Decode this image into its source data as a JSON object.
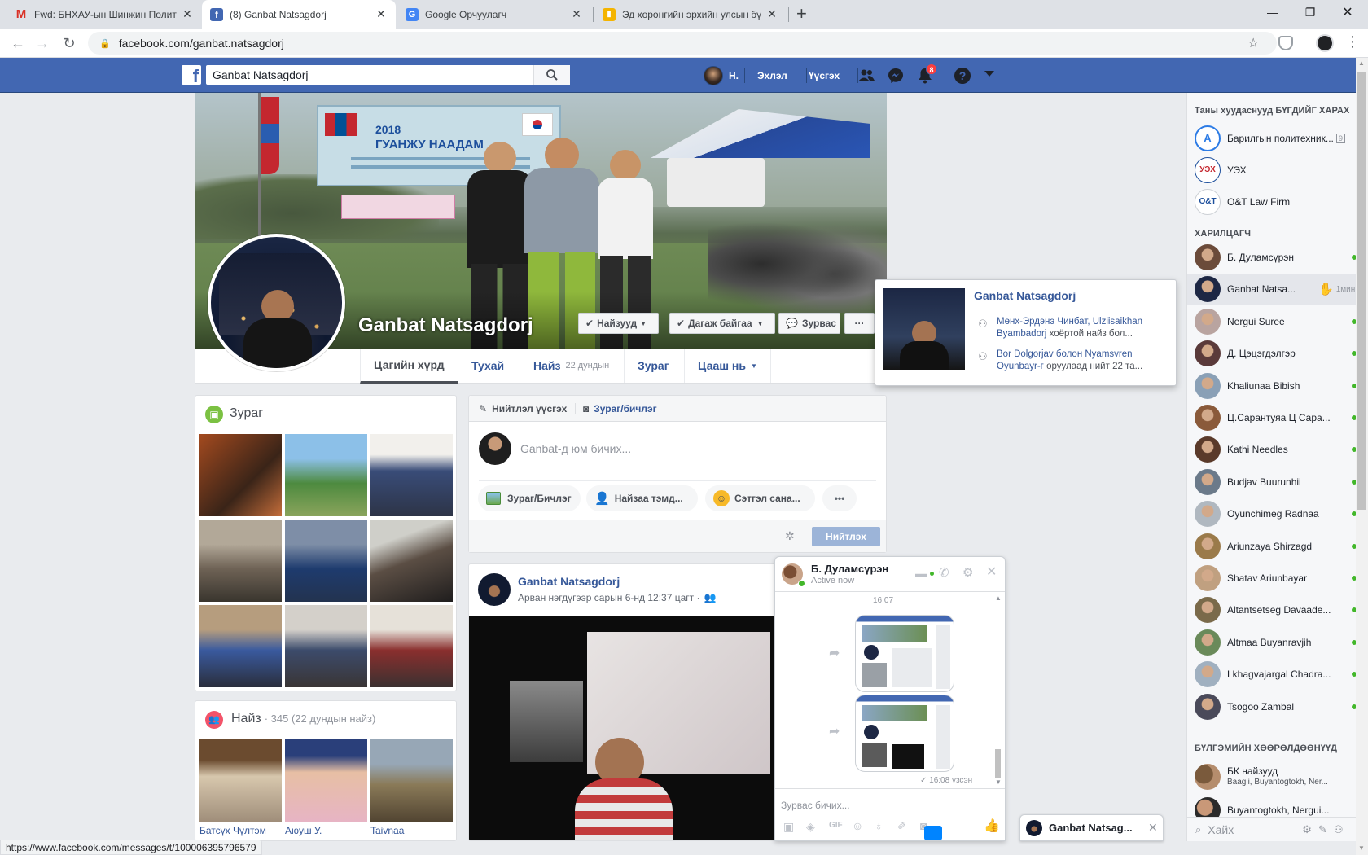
{
  "browser": {
    "tabs": [
      {
        "title": "Fwd: БНХАУ-ын Шинжин Полит",
        "favicon": "gmail-icon"
      },
      {
        "title": "(8) Ganbat Natsagdorj",
        "favicon": "facebook-icon",
        "active": true
      },
      {
        "title": "Google Орчуулагч",
        "favicon": "google-translate-icon"
      },
      {
        "title": "Эд хөрөнгийн эрхийн улсын бү",
        "favicon": "document-icon"
      }
    ],
    "url": "facebook.com/ganbat.natsagdorj",
    "status_url": "https://www.facebook.com/messages/t/100006395796579"
  },
  "fb_header": {
    "search_value": "Ganbat Natsagdorj",
    "user_short": "Н.",
    "home": "Эхлэл",
    "create": "Үүсгэх",
    "notification_count": "8"
  },
  "profile": {
    "name": "Ganbat Natsagdorj",
    "friends_button": "Найзууд",
    "following_button": "Дагаж байгаа",
    "message_button": "Зурвас",
    "more": "···",
    "banner_year": "2018",
    "banner_text": "ГУАНЖУ НААДАМ",
    "tabs": [
      {
        "label": "Цагийн хүрд"
      },
      {
        "label": "Тухай"
      },
      {
        "label": "Найз",
        "sub": "22 дундын"
      },
      {
        "label": "Зураг"
      },
      {
        "label": "Цааш нь"
      }
    ]
  },
  "photos_card": {
    "title": "Зураг"
  },
  "friends_card": {
    "title": "Найз",
    "count": "· 345 (22 дундын найз)",
    "friends": [
      "Батсүх Чүлтэм",
      "Аюуш У.",
      "Taivnaa"
    ]
  },
  "composer": {
    "tab_post": "Нийтлэл үүсгэх",
    "tab_photo": "Зураг/бичлэг",
    "placeholder": "Ganbat-д юм бичих...",
    "photo_video": "Зураг/Бичлэг",
    "tag_friends": "Найзаа тэмд...",
    "feeling": "Сэтгэл сана...",
    "more": "•••",
    "publish": "Нийтлэх"
  },
  "post": {
    "author": "Ganbat Natsagdorj",
    "time": "Арван нэгдүгээр сарын 6-нд 12:37 цагт ·"
  },
  "hovercard": {
    "name": "Ganbat Natsagdorj",
    "mutual_names": "Мөнх-Эрдэнэ Чинбат, Ulziisaikhan Byambadorj",
    "mutual_suffix": "хоёртой найз бол...",
    "followed_names": "Bor Dolgorjav болон Nyamsvren Oyunbayr-г",
    "followed_suffix": "оруулаад нийт 22 та..."
  },
  "chat_sidebar": {
    "pages_header": "Таны хуудаснууд БҮГДИЙГ ХАРАХ",
    "pages": [
      "Барилгын политехник...",
      "УЭХ",
      "O&T Law Firm"
    ],
    "contacts_header": "ХАРИЛЦАГЧ",
    "contacts": [
      {
        "name": "Б. Дуламсүрэн",
        "status": "online"
      },
      {
        "name": "Ganbat Natsa...",
        "status": "1мин"
      },
      {
        "name": "Nergui Suree",
        "status": "online"
      },
      {
        "name": "Д. Цэцэгдэлгэр",
        "status": "online"
      },
      {
        "name": "Khaliunaa Bibish",
        "status": "online"
      },
      {
        "name": "Ц.Сарантуяа Ц Сара...",
        "status": "online"
      },
      {
        "name": "Kathi Needles",
        "status": "online"
      },
      {
        "name": "Budjav Buurunhii",
        "status": "online"
      },
      {
        "name": "Oyunchimeg Radnaa",
        "status": "online"
      },
      {
        "name": "Ariunzaya Shirzagd",
        "status": "online"
      },
      {
        "name": "Shatav Ariunbayar",
        "status": "online"
      },
      {
        "name": "Altantsetseg Davaade...",
        "status": "online"
      },
      {
        "name": "Altmaa Buyanravjih",
        "status": "online"
      },
      {
        "name": "Lkhagvajargal Chadra...",
        "status": "online"
      },
      {
        "name": "Tsogoo Zambal",
        "status": "online"
      }
    ],
    "groups_header": "БҮЛГЭМИЙН ХӨӨРӨЛДӨӨНҮҮД",
    "groups": [
      {
        "name": "БК найзууд",
        "sub": "Baagii, Buyantogtokh, Ner..."
      },
      {
        "name": "Buyantogtokh, Nergui..."
      }
    ],
    "search_placeholder": "Хайх"
  },
  "chat_window": {
    "name": "Б. Дуламсүрэн",
    "status": "Active now",
    "time": "16:07",
    "seen": "✓ 16:08 үзсэн",
    "input_placeholder": "Зурвас бичих..."
  },
  "minimized_chat": {
    "name": "Ganbat Natsag..."
  }
}
